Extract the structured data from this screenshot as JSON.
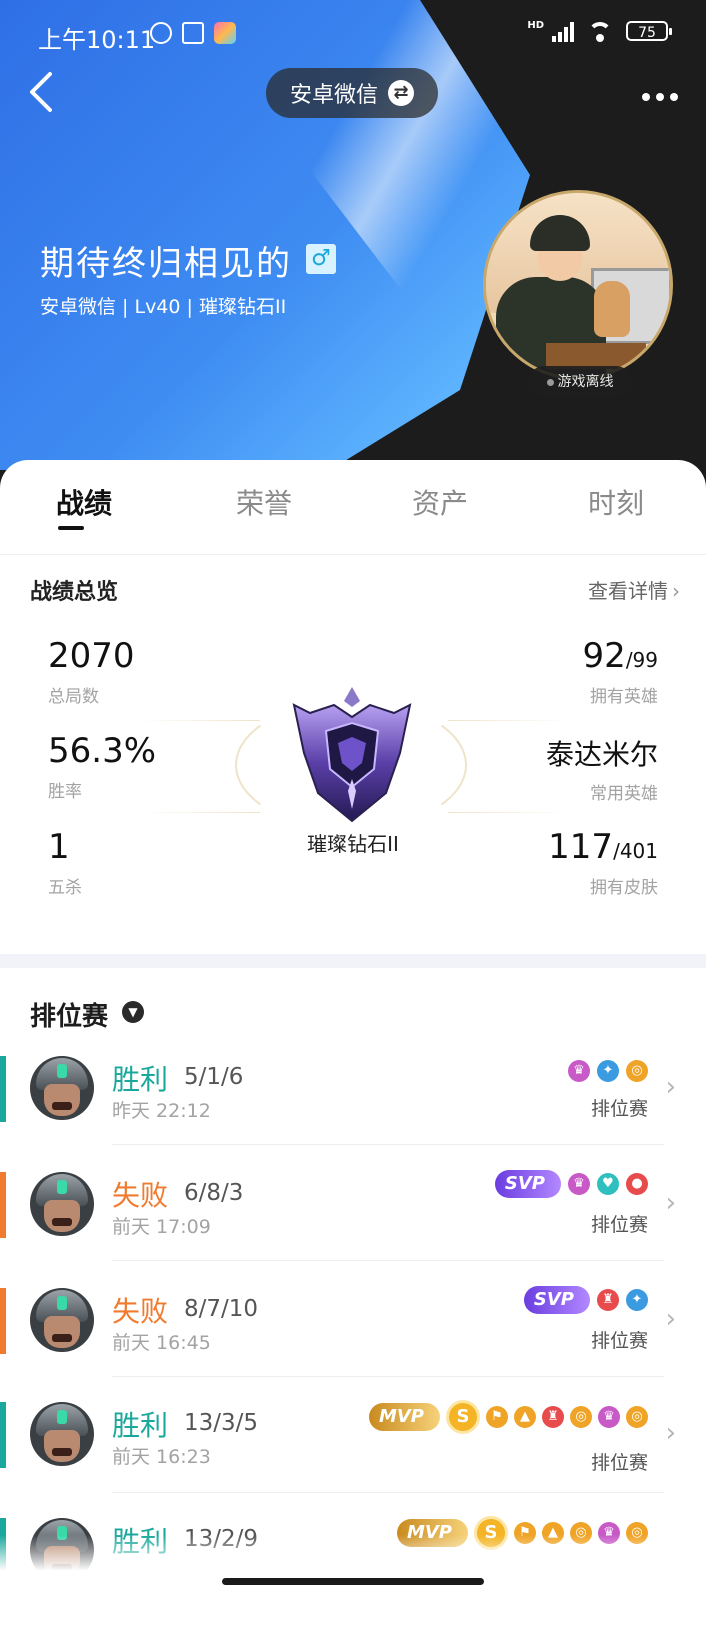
{
  "status_bar": {
    "time": "上午10:11",
    "signal_label": "HD",
    "battery": "75"
  },
  "header": {
    "account_label": "安卓微信",
    "player_name": "期待终归相见的",
    "gender_symbol": "♂",
    "player_meta": "安卓微信 | Lv40 | 璀璨钻石II",
    "online_status": "游戏离线",
    "colors": {
      "blue": "#3e8cf2",
      "dark": "#1c1c1c"
    }
  },
  "tabs": [
    {
      "label": "战绩",
      "active": true
    },
    {
      "label": "荣誉",
      "active": false
    },
    {
      "label": "资产",
      "active": false
    },
    {
      "label": "时刻",
      "active": false
    }
  ],
  "overview": {
    "title": "战绩总览",
    "detail_link": "查看详情",
    "total_games": {
      "value": "2070",
      "label": "总局数"
    },
    "win_rate": {
      "value": "56.3%",
      "label": "胜率"
    },
    "penta_kills": {
      "value": "1",
      "label": "五杀"
    },
    "heroes_owned": {
      "value": "92",
      "total": "/99",
      "label": "拥有英雄"
    },
    "main_hero": {
      "value": "泰达米尔",
      "label": "常用英雄"
    },
    "skins_owned": {
      "value": "117",
      "total": "/401",
      "label": "拥有皮肤"
    },
    "rank_name": "璀璨钻石II",
    "rank_icon": "diamond-rank-emblem"
  },
  "ranked": {
    "title": "排位赛",
    "colors": {
      "win": "#1aa89c",
      "loss": "#f07a2e"
    },
    "matches": [
      {
        "result": "胜利",
        "kda": "5/1/6",
        "time": "昨天 22:12",
        "mode": "排位赛",
        "tag": "",
        "outcome": "win"
      },
      {
        "result": "失败",
        "kda": "6/8/3",
        "time": "前天 17:09",
        "mode": "排位赛",
        "tag": "SVP",
        "outcome": "loss"
      },
      {
        "result": "失败",
        "kda": "8/7/10",
        "time": "前天 16:45",
        "mode": "排位赛",
        "tag": "SVP",
        "outcome": "loss"
      },
      {
        "result": "胜利",
        "kda": "13/3/5",
        "time": "前天 16:23",
        "mode": "排位赛",
        "tag": "MVP",
        "outcome": "win"
      },
      {
        "result": "胜利",
        "kda": "13/2/9",
        "time": "",
        "mode": "",
        "tag": "MVP",
        "outcome": "win"
      }
    ]
  }
}
